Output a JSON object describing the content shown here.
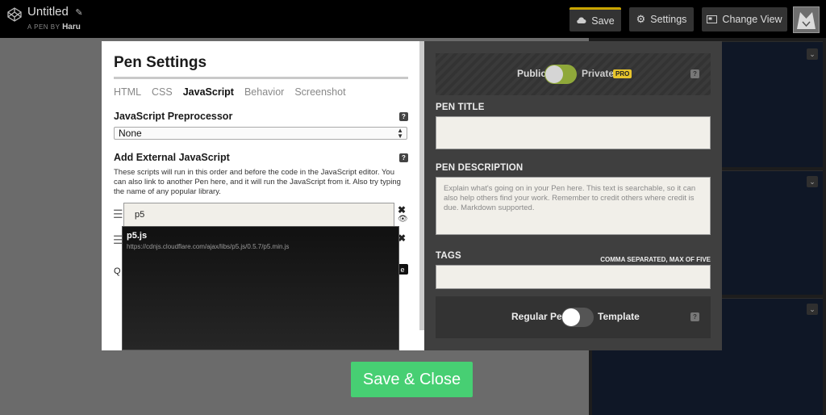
{
  "header": {
    "pen_title": "Untitled",
    "byline_prefix": "A PEN BY",
    "author": "Haru",
    "save_label": "Save",
    "settings_label": "Settings",
    "change_view_label": "Change View"
  },
  "settings": {
    "title": "Pen Settings",
    "tabs": [
      {
        "label": "HTML",
        "active": false
      },
      {
        "label": "CSS",
        "active": false
      },
      {
        "label": "JavaScript",
        "active": true
      },
      {
        "label": "Behavior",
        "active": false
      },
      {
        "label": "Screenshot",
        "active": false
      }
    ],
    "preprocessor_heading": "JavaScript Preprocessor",
    "preprocessor_value": "None",
    "external_heading": "Add External JavaScript",
    "external_description": "These scripts will run in this order and before the code in the JavaScript editor. You can also link to another Pen here, and it will run the JavaScript from it. Also try typing the name of any popular library.",
    "external_input_value": "p5",
    "partial_text": "Q",
    "partial_button": "e",
    "help_glyph": "?",
    "suggestion": {
      "name": "p5.js",
      "url": "https://cdnjs.cloudflare.com/ajax/libs/p5.js/0.5.7/p5.min.js"
    }
  },
  "details": {
    "public_label": "Public",
    "private_label": "Private",
    "pro_badge": "PRO",
    "title_label": "PEN TITLE",
    "title_value": "",
    "description_label": "PEN DESCRIPTION",
    "description_placeholder": "Explain what's going on in your Pen here. This text is searchable, so it can also help others find your work. Remember to credit others where credit is due. Markdown supported.",
    "tags_label": "TAGS",
    "tags_note": "COMMA SEPARATED, MAX OF FIVE",
    "tags_value": "",
    "regular_label": "Regular Pen",
    "template_label": "Template"
  },
  "save_close_label": "Save & Close",
  "colors": {
    "accent_green": "#47cf73",
    "pro_yellow": "#e7c42c",
    "toggle_green": "#8fa83a"
  }
}
